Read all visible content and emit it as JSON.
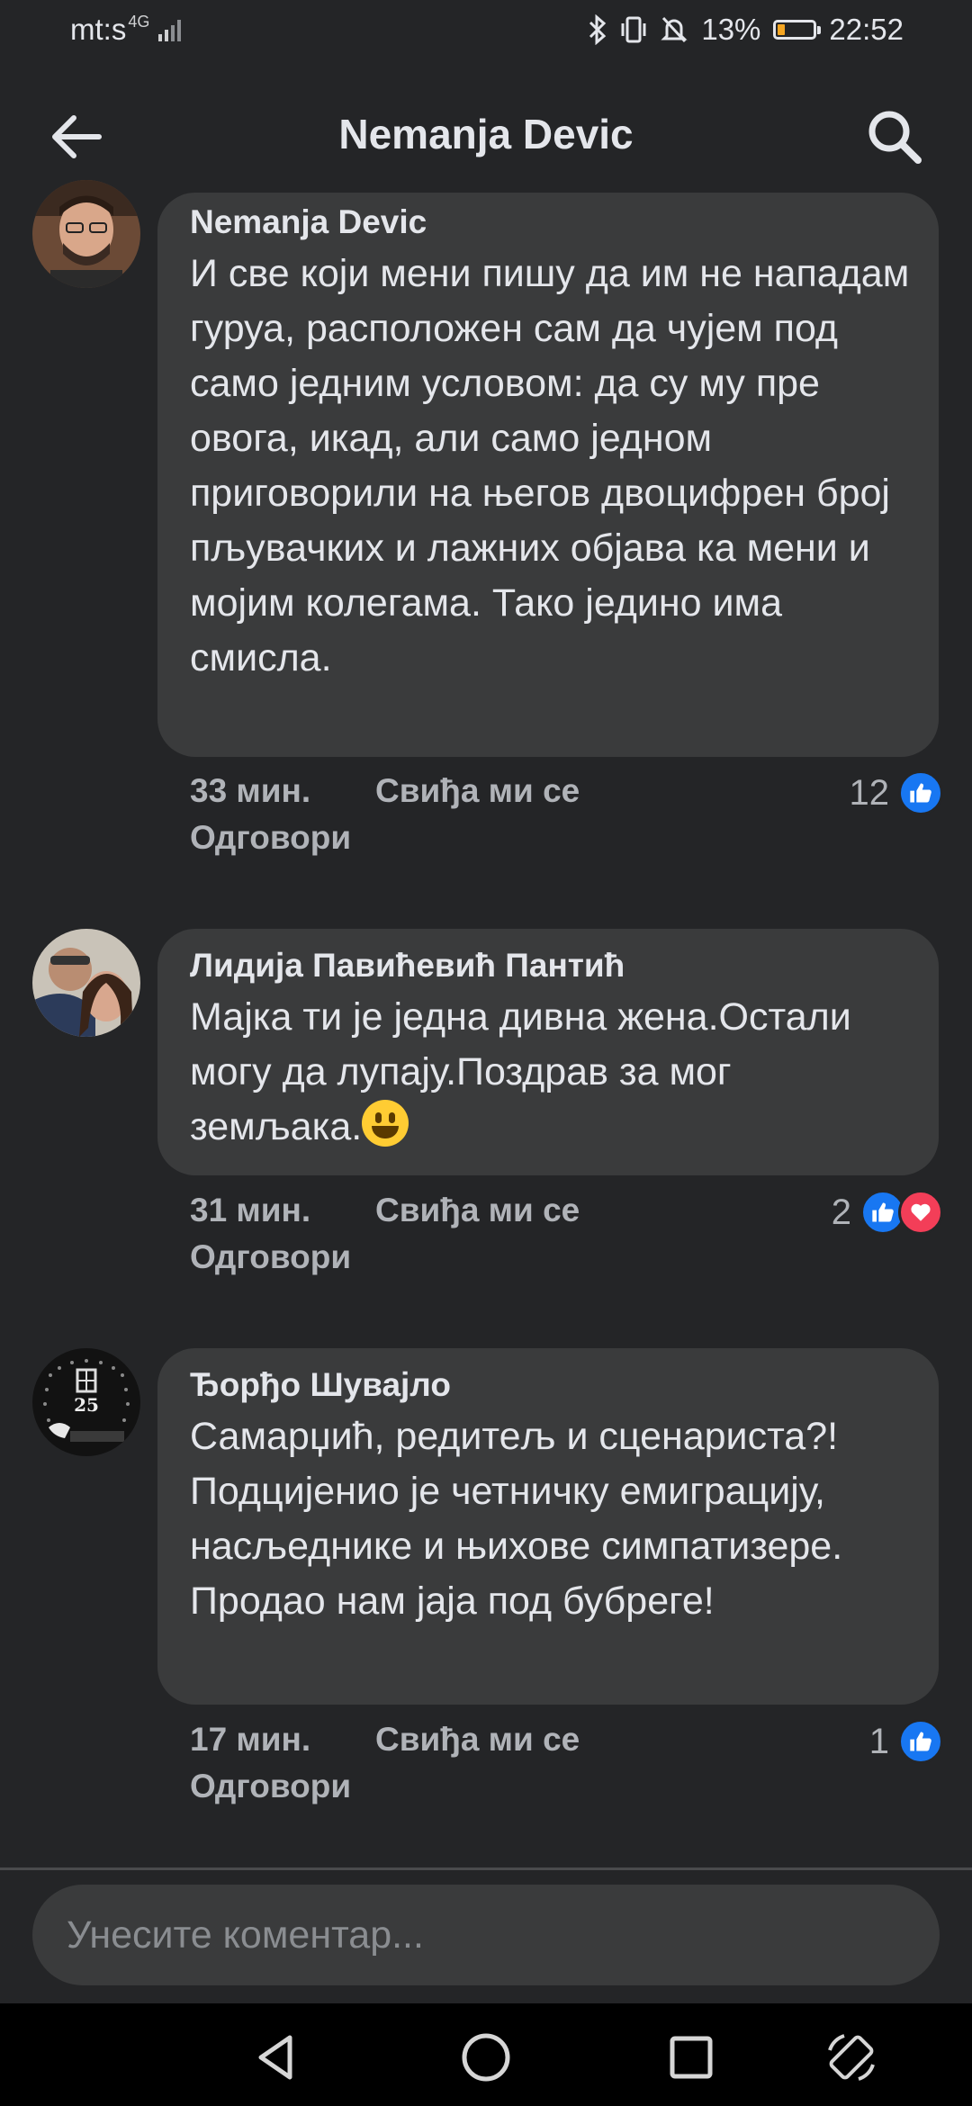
{
  "status_bar": {
    "carrier": "mt:s",
    "network": "4G",
    "battery_percent": "13%",
    "time": "22:52",
    "battery_level": 0.13
  },
  "header": {
    "title": "Nemanja Devic"
  },
  "comments": [
    {
      "author": "Nemanja Devic",
      "text": "И све који мени пишу да им не нападам гуруа, расположен сам да чујем под само једним условом: да су му пре овога, икад, али само једном приговорили на његов двоцифрен број пљувачких и лажних објава ка мени и мојим колегама. Тако једино има смисла.",
      "time": "33 мин.",
      "like_label": "Свиђа ми се",
      "reply_label": "Одговори",
      "reaction_count": "12",
      "reactions": [
        "like-icon"
      ]
    },
    {
      "author": "Лидија Павићевић Пантић",
      "text": "Мајка ти је једна дивна жена.Остали могу да лупају.Поздрав за мог земљака.",
      "time": "31 мин.",
      "like_label": "Свиђа ми се",
      "reply_label": "Одговори",
      "reaction_count": "2",
      "reactions": [
        "like-icon",
        "love-icon"
      ]
    },
    {
      "author": "Ђорђо Шувајло",
      "text": "Самарџић, редитељ и сценариста?! Подцијенио је четничку емиграцију, насљеднике и њихове симпатизере. Продао нам јаја под бубреге!",
      "time": "17 мин.",
      "like_label": "Свиђа ми се",
      "reply_label": "Одговори",
      "reaction_count": "1",
      "reactions": [
        "like-icon"
      ]
    }
  ],
  "composer": {
    "placeholder": "Унесите коментар..."
  },
  "colors": {
    "background": "#242527",
    "bubble": "#3a3b3c",
    "like_blue": "#1877f2",
    "love_red": "#f33e58",
    "battery_low": "#f5a623"
  }
}
